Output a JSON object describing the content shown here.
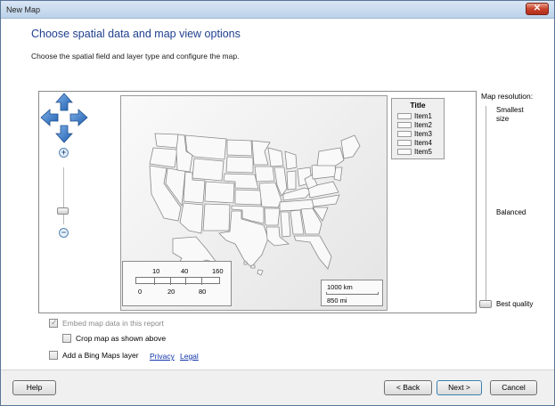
{
  "window": {
    "title": "New Map"
  },
  "header": {
    "title": "Choose spatial data and map view options",
    "subtitle": "Choose the spatial field and layer type and configure the map."
  },
  "map": {
    "legend": {
      "title": "Title",
      "items": [
        "Item1",
        "Item2",
        "Item3",
        "Item4",
        "Item5"
      ]
    },
    "color_scale": {
      "top_labels": [
        "10",
        "40",
        "160"
      ],
      "bottom_labels": [
        "0",
        "20",
        "80"
      ]
    },
    "distance_scale": {
      "km": "1000 km",
      "mi": "850 mi"
    }
  },
  "resolution": {
    "label": "Map resolution:",
    "smallest": "Smallest\nsize",
    "balanced": "Balanced",
    "best": "Best quality",
    "selected": "Best quality"
  },
  "options": {
    "embed": {
      "label": "Embed map data in this report",
      "checked": true,
      "enabled": false
    },
    "crop": {
      "label": "Crop map as shown above",
      "checked": false
    },
    "bing": {
      "label": "Add a Bing Maps layer",
      "checked": false
    },
    "privacy_link": "Privacy",
    "legal_link": "Legal"
  },
  "buttons": {
    "help": "Help",
    "back": "< Back",
    "next": "Next >",
    "cancel": "Cancel"
  }
}
